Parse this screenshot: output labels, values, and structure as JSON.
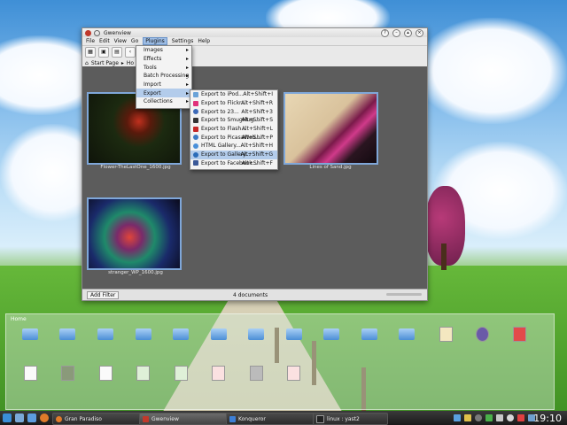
{
  "window": {
    "title": "Gwenview",
    "menubar": [
      "File",
      "Edit",
      "View",
      "Go",
      "Plugins",
      "Settings",
      "Help"
    ],
    "breadcrumb": {
      "start": "Start Page",
      "home": "Ho"
    },
    "status": {
      "filter_label": "Add Filter",
      "count": "4 documents"
    }
  },
  "plugins_menu": {
    "items": [
      {
        "label": "Images",
        "submenu": true
      },
      {
        "label": "Effects",
        "submenu": true
      },
      {
        "label": "Tools",
        "submenu": true
      },
      {
        "label": "Batch Processing",
        "submenu": true
      },
      {
        "label": "Import",
        "submenu": true
      },
      {
        "label": "Export",
        "submenu": true,
        "highlighted": true
      },
      {
        "label": "Collections",
        "submenu": true
      }
    ]
  },
  "export_menu": {
    "items": [
      {
        "label": "Export to iPod...",
        "shortcut": "Alt+Shift+I",
        "icon": "ipod-icon",
        "color": "#6aa3d8"
      },
      {
        "label": "Export to Flickr...",
        "shortcut": "Alt+Shift+R",
        "icon": "flickr-icon",
        "color": "#e0307a"
      },
      {
        "label": "Export to 23...",
        "shortcut": "Alt+Shift+3",
        "icon": "23hq-icon",
        "color": "#3d6ab8"
      },
      {
        "label": "Export to SmugMug...",
        "shortcut": "Alt+Shift+S",
        "icon": "smugmug-icon",
        "color": "#333333"
      },
      {
        "label": "Export to Flash...",
        "shortcut": "Alt+Shift+L",
        "icon": "flash-icon",
        "color": "#c62828"
      },
      {
        "label": "Export to PicasaWeb...",
        "shortcut": "Alt+Shift+P",
        "icon": "picasa-icon",
        "color": "#3c79c4"
      },
      {
        "label": "HTML Gallery...",
        "shortcut": "Alt+Shift+H",
        "icon": "html-gallery-icon",
        "color": "#4a90d9"
      },
      {
        "label": "Export to Gallery...",
        "shortcut": "Alt+Shift+G",
        "icon": "gallery-icon",
        "color": "#2b6cb8",
        "highlighted": true
      },
      {
        "label": "Export to Facebook...",
        "shortcut": "Alt+Shift+F",
        "icon": "facebook-icon",
        "color": "#3b5998"
      }
    ]
  },
  "thumbnails": [
    {
      "caption": "Flower-TheLastOne_1600.jpg"
    },
    {
      "caption": "Lines of Sand.jpg"
    },
    {
      "caption": "stranger_WP_1600.jpg"
    }
  ],
  "folder_panel": {
    "title": "Home"
  },
  "taskbar": {
    "tasks": [
      {
        "label": "Gran Paradiso"
      },
      {
        "label": "Gwenview"
      },
      {
        "label": "Konqueror"
      },
      {
        "label": "linux : yast2"
      }
    ],
    "clock": "19:10"
  },
  "colors": {
    "menu_highlight": "#b3cceb",
    "accent": "#7fa7d9"
  }
}
